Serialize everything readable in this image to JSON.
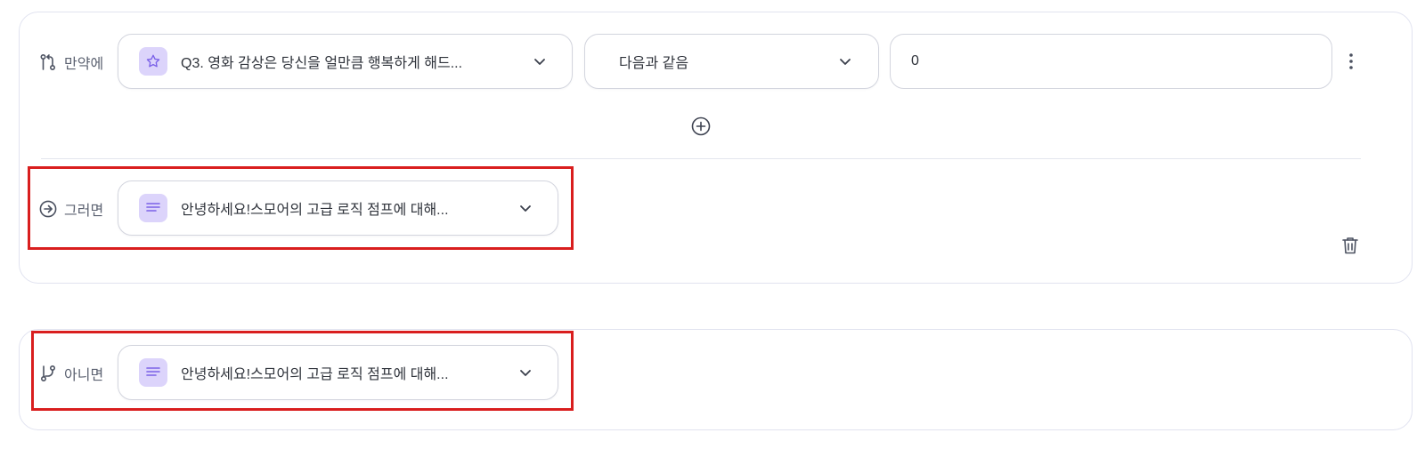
{
  "if_block": {
    "label": "만약에",
    "question_select": {
      "value": "Q3. 영화 감상은 당신을 얼만큼 행복하게 해드...",
      "icon": "star-icon"
    },
    "operator_select": {
      "value": "다음과 같음"
    },
    "value_input": {
      "value": "0"
    },
    "add_condition_icon": "plus-circle-icon",
    "more_icon": "kebab-menu-icon"
  },
  "then_block": {
    "label": "그러면",
    "target_select": {
      "value": "안녕하세요!스모어의 고급 로직 점프에 대해...",
      "icon": "text-lines-icon"
    },
    "delete_icon": "trash-icon"
  },
  "else_block": {
    "label": "아니면",
    "target_select": {
      "value": "안녕하세요!스모어의 고급 로직 점프에 대해...",
      "icon": "text-lines-icon"
    }
  },
  "colors": {
    "accent_purple": "#7b61e8",
    "icon_bg": "#dcd4fb",
    "highlight_red": "#d91e1e",
    "border": "#d3d5de"
  }
}
